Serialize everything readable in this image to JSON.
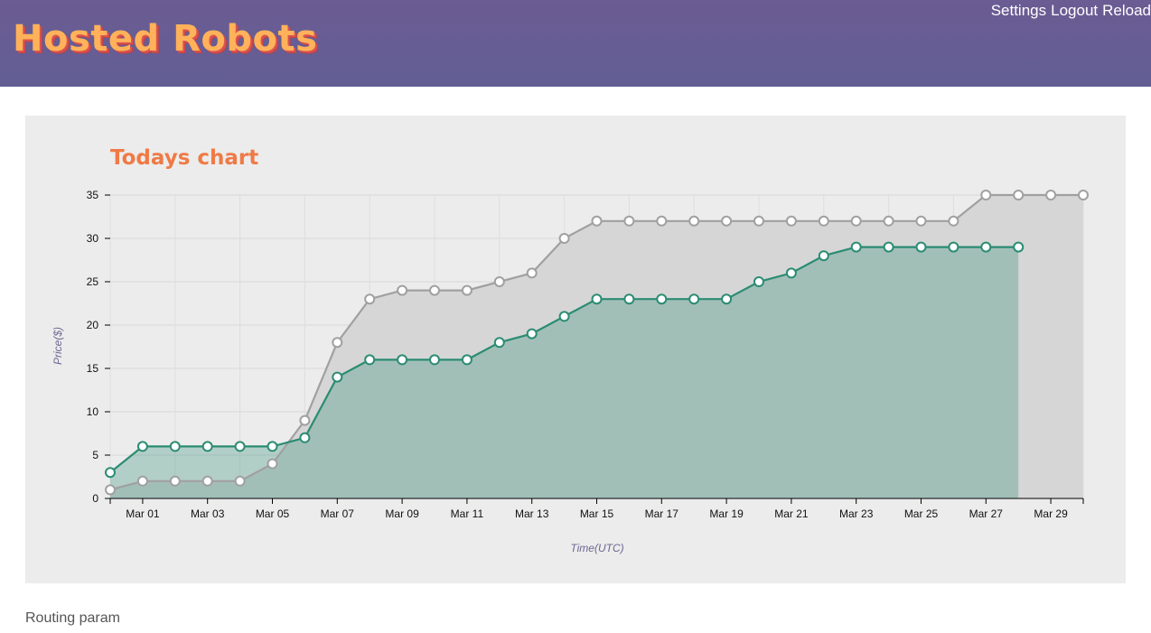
{
  "header": {
    "brand": "Hosted Robots",
    "nav": {
      "settings": "Settings",
      "logout": "Logout",
      "reload": "Reload"
    }
  },
  "chart": {
    "title": "Todays chart"
  },
  "footer": {
    "routing_label": "Routing param"
  },
  "colors": {
    "header_bg": "#6b5c93",
    "brand": "#ffb25a",
    "title": "#ef7a45",
    "series_gray": "#a0a0a0",
    "series_green": "#2b8c72"
  },
  "chart_data": {
    "type": "area",
    "title": "Todays chart",
    "xlabel": "Time(UTC)",
    "ylabel": "Price($)",
    "ylim": [
      0,
      35
    ],
    "yticks": [
      0,
      5,
      10,
      15,
      20,
      25,
      30,
      35
    ],
    "xlim": [
      "2024-02-29",
      "2024-03-30"
    ],
    "xtick_labels": [
      "Mar 01",
      "Mar 03",
      "Mar 05",
      "Mar 07",
      "Mar 09",
      "Mar 11",
      "Mar 13",
      "Mar 15",
      "Mar 17",
      "Mar 19",
      "Mar 21",
      "Mar 23",
      "Mar 25",
      "Mar 27",
      "Mar 29"
    ],
    "xtick_dates": [
      "2024-03-01",
      "2024-03-03",
      "2024-03-05",
      "2024-03-07",
      "2024-03-09",
      "2024-03-11",
      "2024-03-13",
      "2024-03-15",
      "2024-03-17",
      "2024-03-19",
      "2024-03-21",
      "2024-03-23",
      "2024-03-25",
      "2024-03-27",
      "2024-03-29"
    ],
    "grid": true,
    "series": [
      {
        "color": "#a0a0a0",
        "fill": "#d6d6d6",
        "x": [
          "2024-02-29",
          "2024-03-01",
          "2024-03-02",
          "2024-03-03",
          "2024-03-04",
          "2024-03-05",
          "2024-03-06",
          "2024-03-07",
          "2024-03-08",
          "2024-03-09",
          "2024-03-10",
          "2024-03-11",
          "2024-03-12",
          "2024-03-13",
          "2024-03-14",
          "2024-03-15",
          "2024-03-16",
          "2024-03-17",
          "2024-03-18",
          "2024-03-19",
          "2024-03-20",
          "2024-03-21",
          "2024-03-22",
          "2024-03-23",
          "2024-03-24",
          "2024-03-25",
          "2024-03-26",
          "2024-03-27",
          "2024-03-28",
          "2024-03-29",
          "2024-03-30"
        ],
        "values": [
          1,
          2,
          2,
          2,
          2,
          4,
          9,
          18,
          23,
          24,
          24,
          24,
          25,
          26,
          30,
          32,
          32,
          32,
          32,
          32,
          32,
          32,
          32,
          32,
          32,
          32,
          32,
          35,
          35,
          35,
          35
        ]
      },
      {
        "color": "#2b8c72",
        "fill": "rgba(43,140,114,0.30)",
        "x": [
          "2024-02-29",
          "2024-03-01",
          "2024-03-02",
          "2024-03-03",
          "2024-03-04",
          "2024-03-05",
          "2024-03-06",
          "2024-03-07",
          "2024-03-08",
          "2024-03-09",
          "2024-03-10",
          "2024-03-11",
          "2024-03-12",
          "2024-03-13",
          "2024-03-14",
          "2024-03-15",
          "2024-03-16",
          "2024-03-17",
          "2024-03-18",
          "2024-03-19",
          "2024-03-20",
          "2024-03-21",
          "2024-03-22",
          "2024-03-23",
          "2024-03-24",
          "2024-03-25",
          "2024-03-26",
          "2024-03-27",
          "2024-03-28"
        ],
        "values": [
          3,
          6,
          6,
          6,
          6,
          6,
          7,
          14,
          16,
          16,
          16,
          16,
          18,
          19,
          21,
          23,
          23,
          23,
          23,
          23,
          25,
          26,
          28,
          29,
          29,
          29,
          29,
          29,
          29
        ]
      }
    ]
  }
}
